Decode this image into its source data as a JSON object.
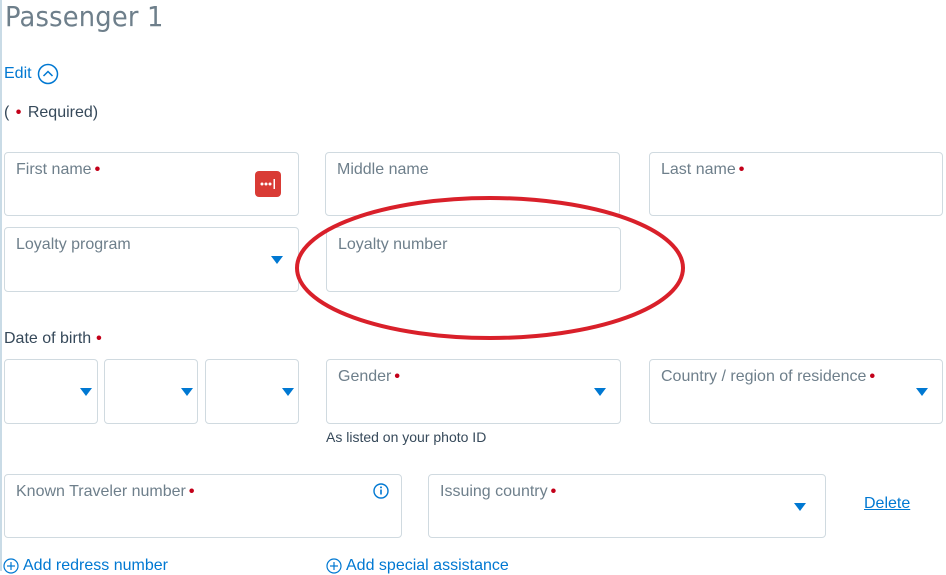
{
  "title": "Passenger 1",
  "edit": {
    "label": "Edit",
    "icon": "chevron-up-circle-icon"
  },
  "required_note": {
    "open": "(",
    "dot": "•",
    "text": "Required)"
  },
  "colors": {
    "accent": "#0078d2",
    "required_dot": "#c30019",
    "annotation": "#d9202a",
    "password_manager_icon": "#d93b35"
  },
  "fields": {
    "first_name": {
      "label": "First name",
      "required": "•",
      "value": ""
    },
    "middle_name": {
      "label": "Middle name",
      "value": ""
    },
    "last_name": {
      "label": "Last name",
      "required": "•",
      "value": ""
    },
    "loyalty_program": {
      "label": "Loyalty program",
      "value": ""
    },
    "loyalty_number": {
      "label": "Loyalty number",
      "value": ""
    },
    "gender": {
      "label": "Gender",
      "required": "•",
      "value": ""
    },
    "country_residence": {
      "label": "Country / region of residence",
      "required": "•",
      "value": ""
    },
    "known_traveler": {
      "label": "Known Traveler number",
      "required": "•",
      "value": ""
    },
    "issuing_country": {
      "label": "Issuing country",
      "required": "•",
      "value": ""
    }
  },
  "date_of_birth": {
    "label": "Date of birth",
    "required": "•",
    "selects": [
      {
        "value": ""
      },
      {
        "value": ""
      },
      {
        "value": ""
      }
    ]
  },
  "gender_hint": "As listed on your photo ID",
  "delete_label": "Delete",
  "add_redress_label": "Add redress number",
  "add_special_assistance_label": "Add special assistance",
  "annotation": {
    "shape": "ellipse",
    "highlights": "loyalty_number"
  }
}
